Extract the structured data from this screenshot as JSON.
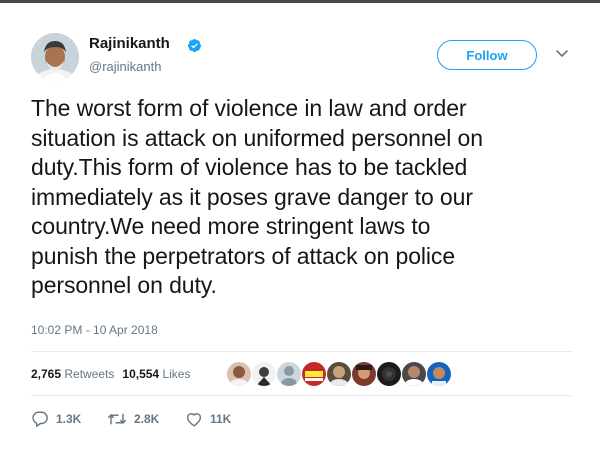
{
  "user": {
    "name": "Rajinikanth",
    "handle": "@rajinikanth",
    "verified": true
  },
  "follow_button": {
    "label": "Follow"
  },
  "tweet": {
    "lines": [
      "The worst form of violence in law and order",
      "situation is attack on uniformed personnel on",
      "duty.This form of violence has to be tackled",
      "immediately as it poses grave danger to our",
      "country.We need more stringent laws to",
      "punish the perpetrators of attack on police",
      "personnel on duty."
    ],
    "timestamp": "10:02 PM - 10 Apr 2018"
  },
  "stats": {
    "retweets_count": "2,765",
    "retweets_label": "Retweets",
    "likes_count": "10,554",
    "likes_label": "Likes"
  },
  "actions": {
    "replies": "1.3K",
    "retweets": "2.8K",
    "likes": "11K"
  },
  "colors": {
    "accent": "#1da1f2",
    "secondary_text": "#657786",
    "primary_text": "#14171a"
  },
  "icons": [
    "verified-badge-icon",
    "chevron-down-icon",
    "reply-icon",
    "retweet-icon",
    "like-icon"
  ]
}
